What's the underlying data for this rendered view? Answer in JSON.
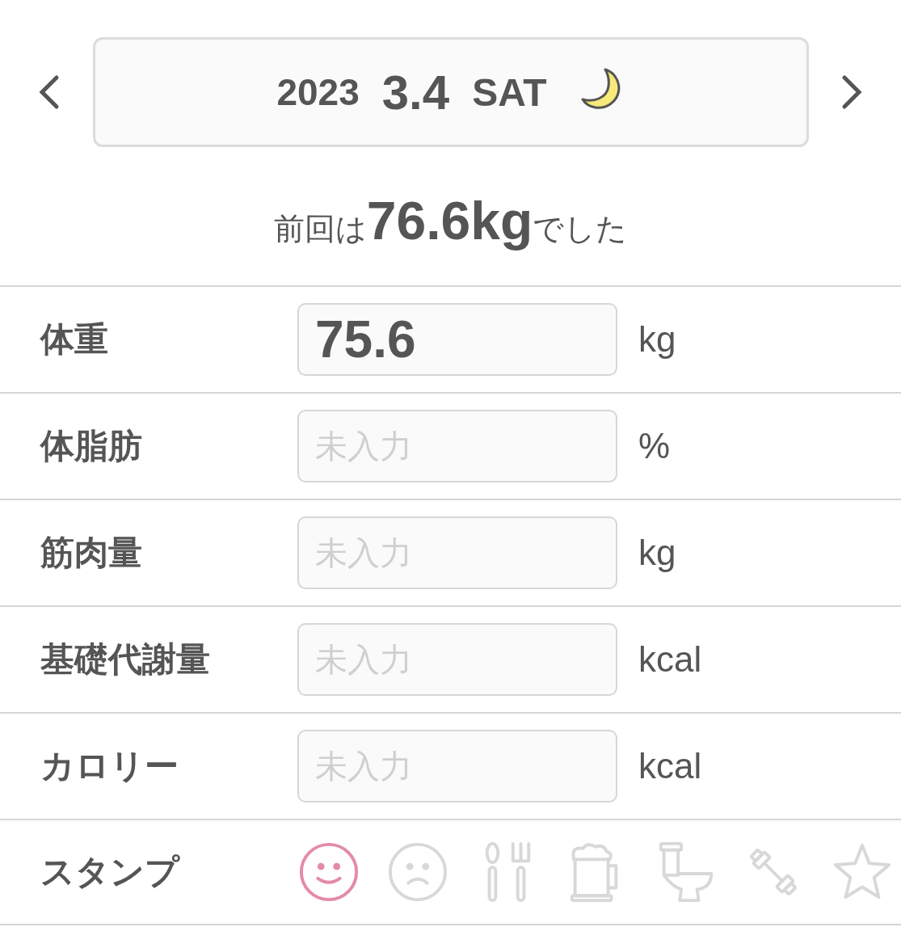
{
  "date": {
    "year": "2023",
    "day": "3.4",
    "weekday": "SAT"
  },
  "previous": "前回は**76.6kg**でした",
  "rows": [
    {
      "label": "体重",
      "value": "75.6",
      "unit": "kg"
    },
    {
      "label": "体脂肪",
      "placeholder": "未入力",
      "unit": "%"
    },
    {
      "label": "筋肉量",
      "placeholder": "未入力",
      "unit": "kg"
    },
    {
      "label": "基礎代謝量",
      "placeholder": "未入力",
      "unit": "kcal"
    },
    {
      "label": "カロリー",
      "placeholder": "未入力",
      "unit": "kcal"
    }
  ],
  "stamp_label": "スタンプ",
  "stamps": [
    {
      "kind": "smile",
      "selected": true
    },
    {
      "kind": "frown",
      "selected": false
    },
    {
      "kind": "cutlery",
      "selected": false
    },
    {
      "kind": "beer",
      "selected": false
    },
    {
      "kind": "toilet",
      "selected": false
    },
    {
      "kind": "dumbbell",
      "selected": false
    },
    {
      "kind": "star",
      "selected": false
    }
  ]
}
